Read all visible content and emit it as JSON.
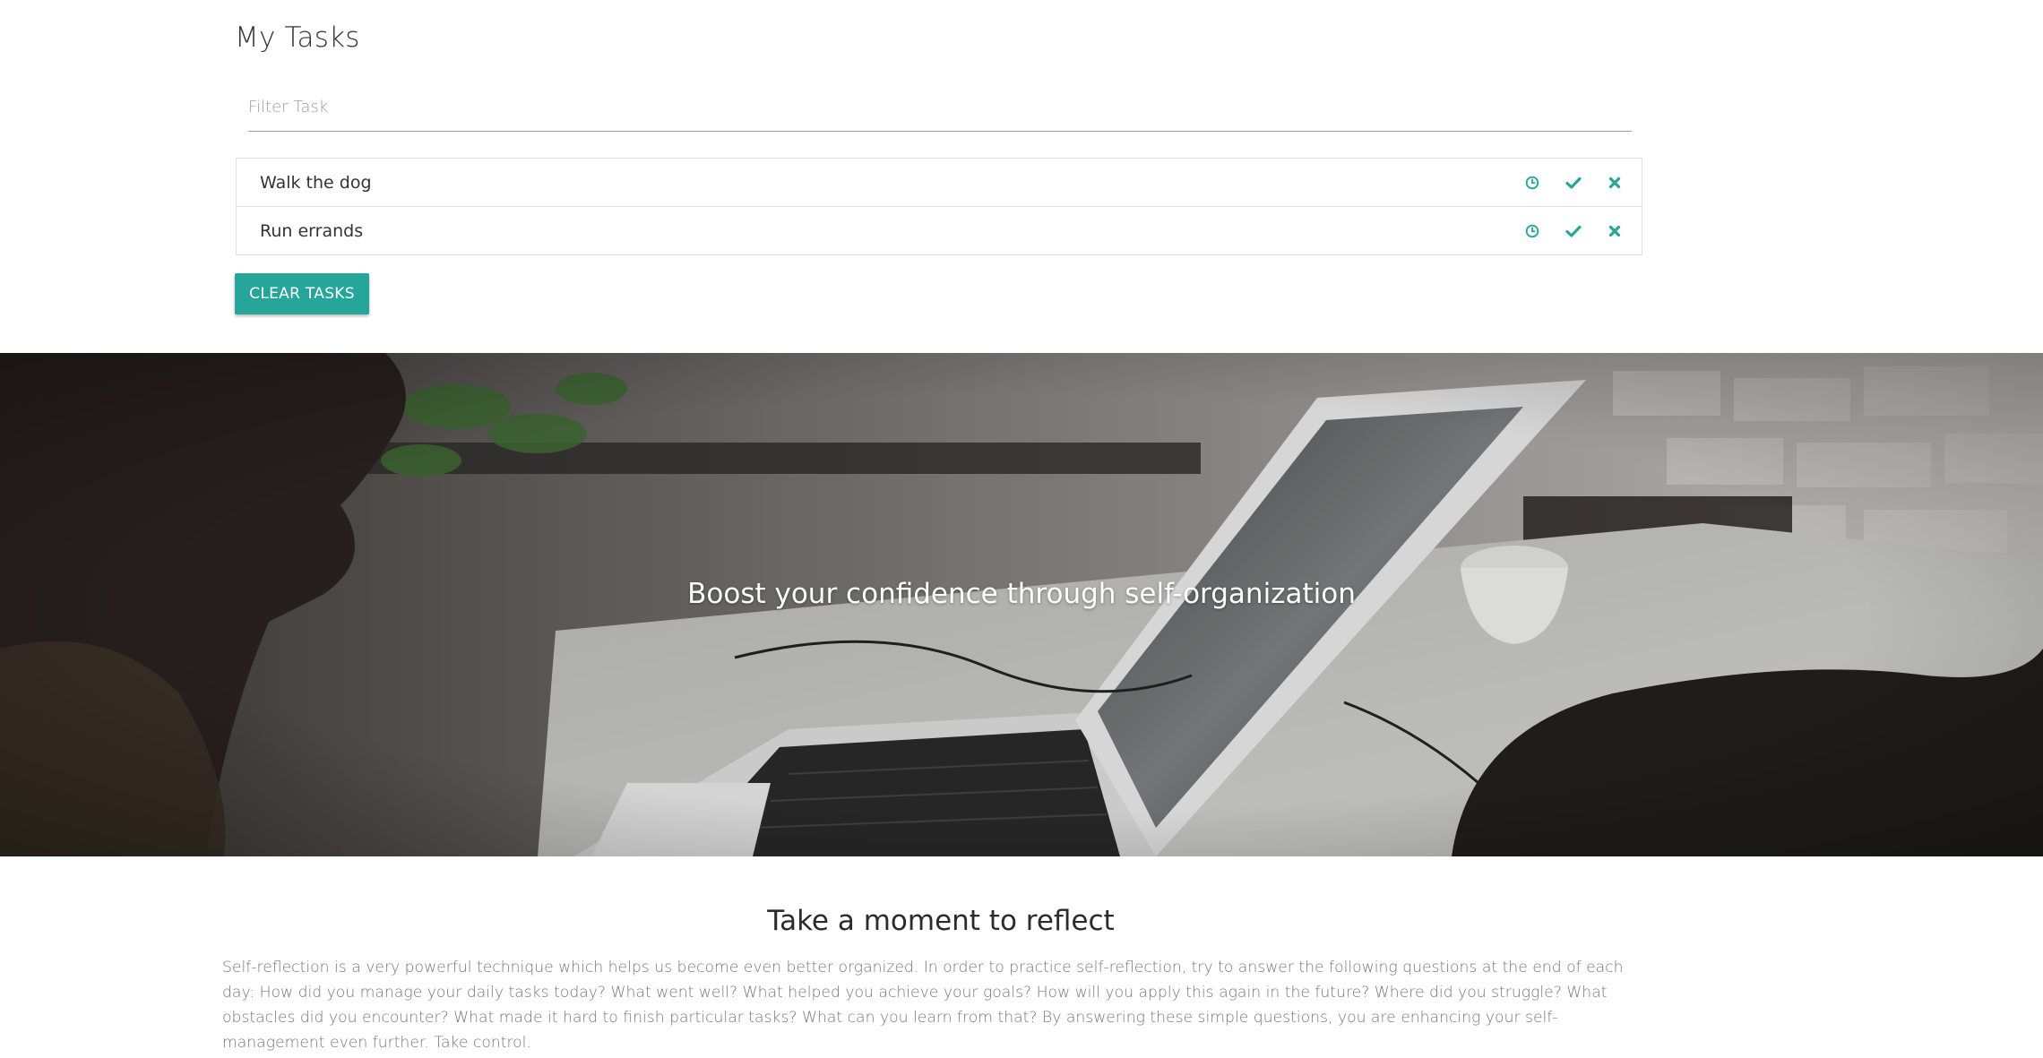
{
  "tasks": {
    "title": "My Tasks",
    "filter_placeholder": "Filter Task",
    "items": [
      {
        "label": "Walk the dog"
      },
      {
        "label": "Run errands"
      }
    ],
    "clear_label": "Clear Tasks",
    "icons": [
      "clock-icon",
      "check-icon",
      "close-icon"
    ]
  },
  "hero": {
    "headline": "Boost your confidence through self-organization"
  },
  "reflect": {
    "title": "Take a moment to reflect",
    "body": "Self-reflection is a very powerful technique which helps us become even better organized. In order to practice self-reflection, try to answer the following questions at the end of each day: How did you manage your daily tasks today? What went well? What helped you achieve your goals? How will you apply this again in the future? Where did you struggle? What obstacles did you encounter? What made it hard to finish particular tasks? What can you learn from that? By answering these simple questions, you are enhancing your self-management even further. Take control."
  },
  "colors": {
    "accent": "#26a69a",
    "border": "#e0e0e0",
    "muted_text": "#777777"
  }
}
